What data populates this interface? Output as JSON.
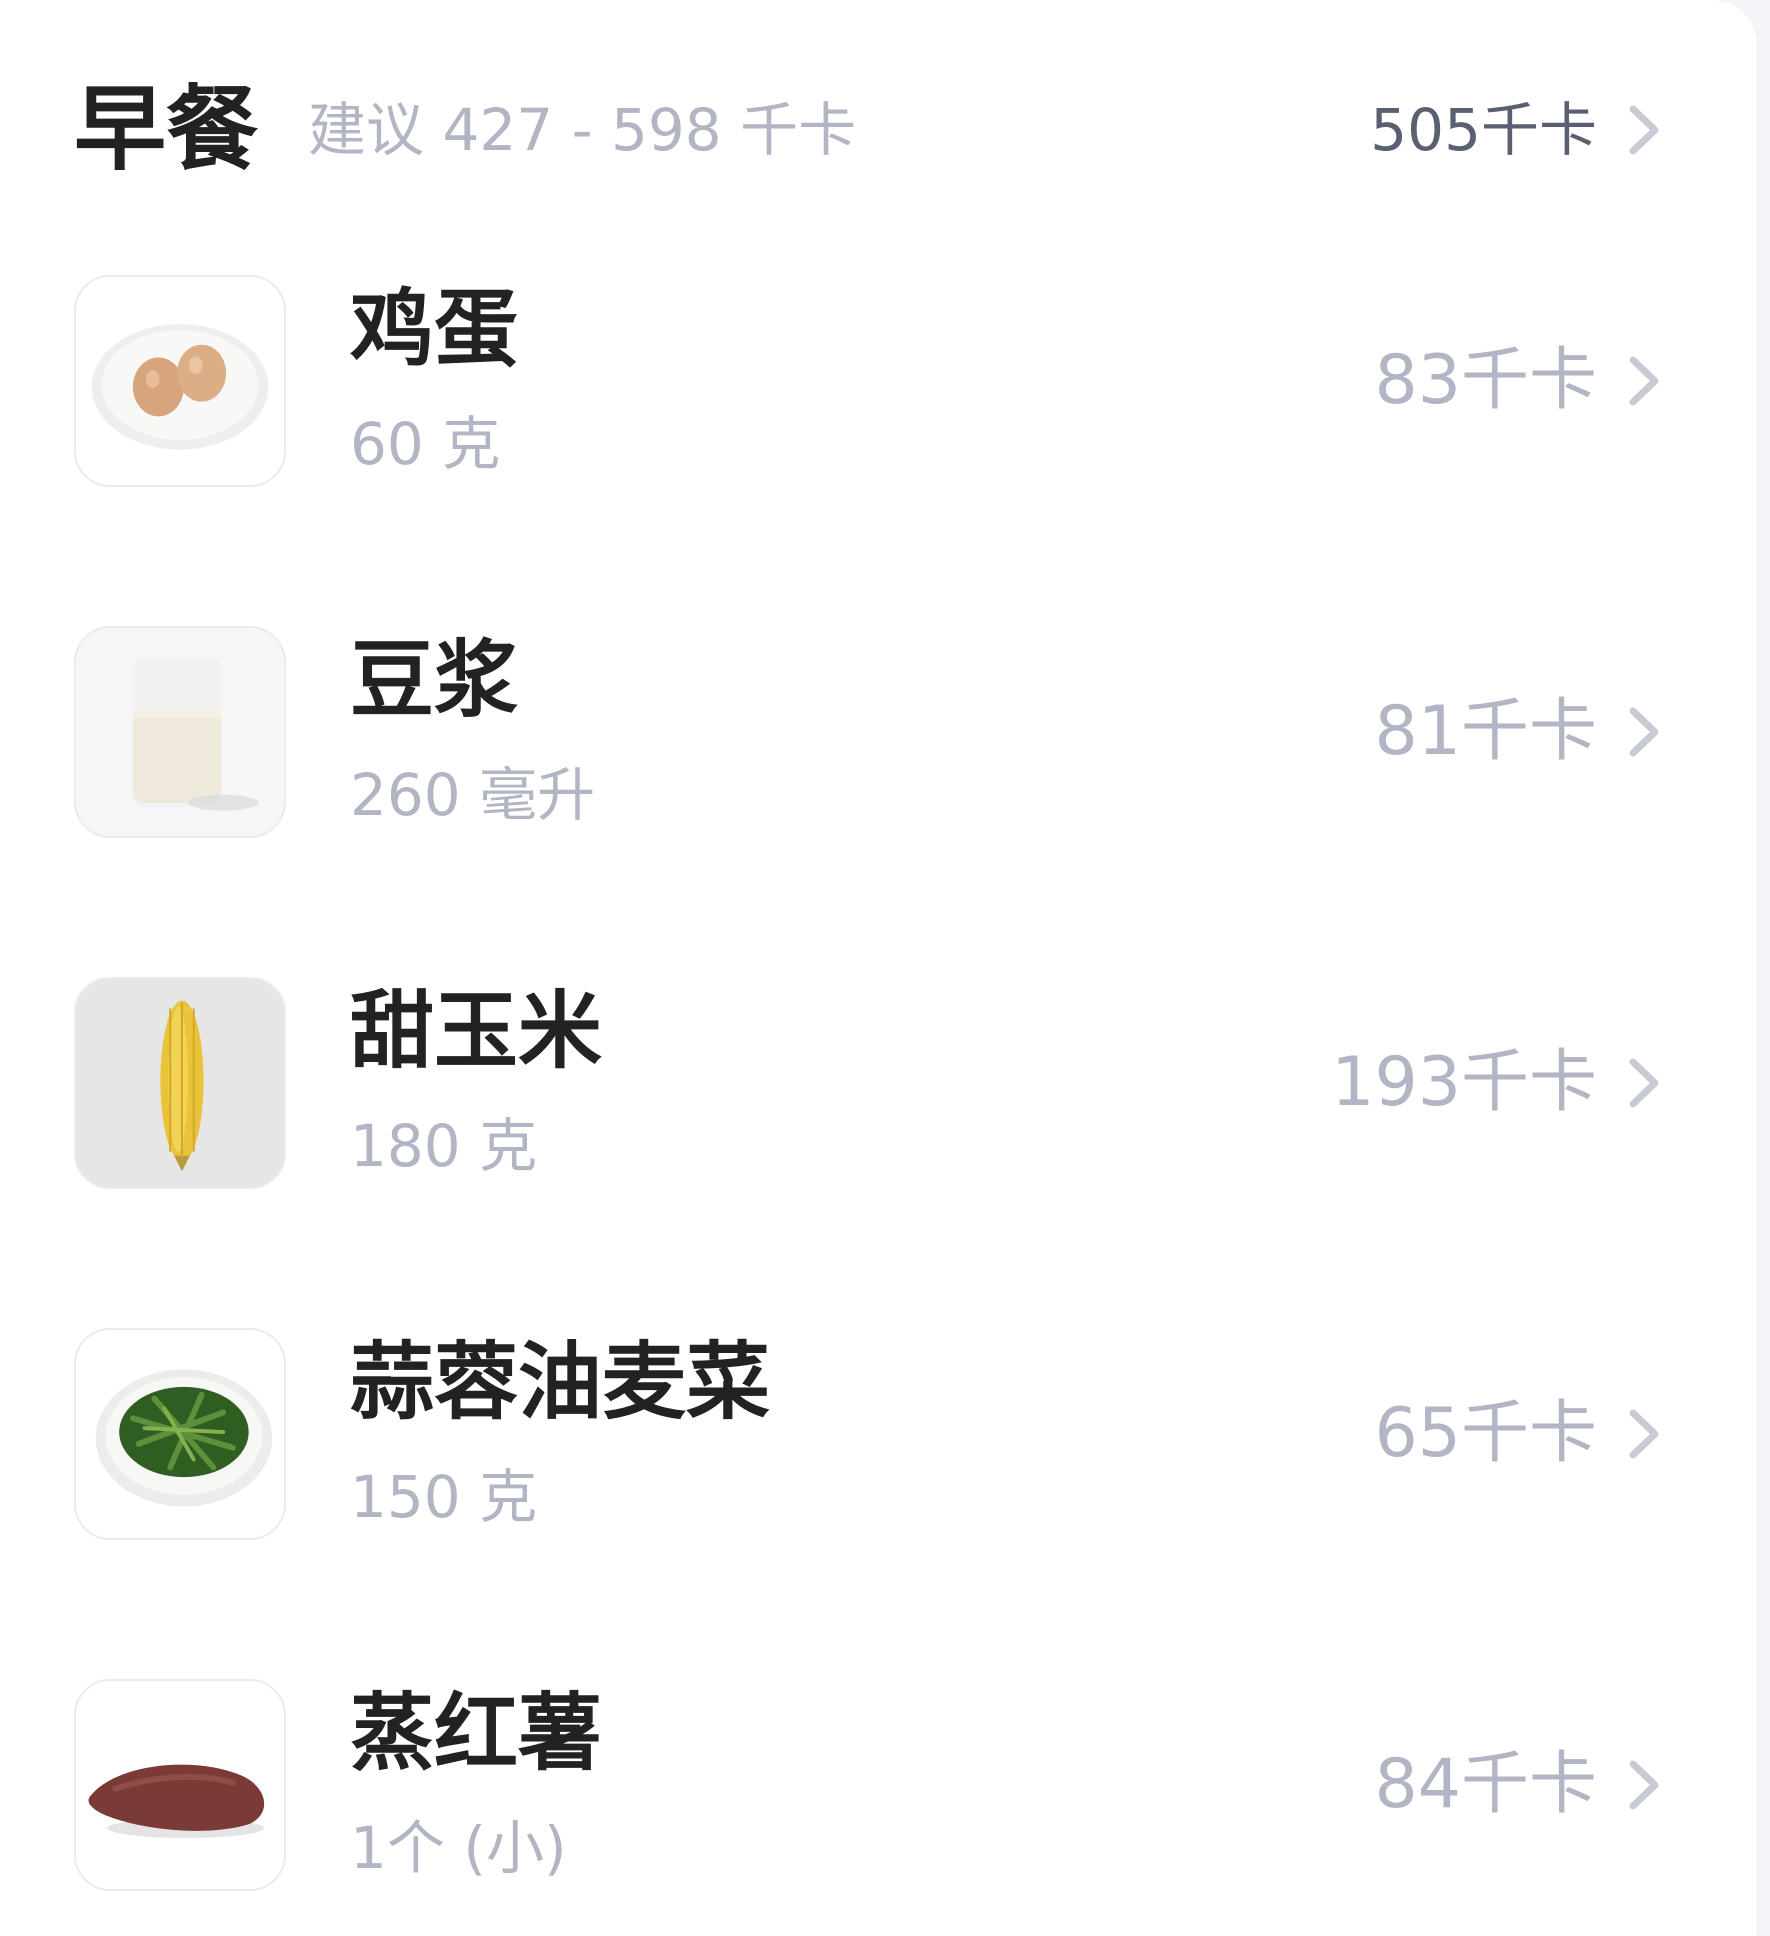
{
  "meal": {
    "title": "早餐",
    "suggestion": "建议 427 - 598 千卡",
    "total": "505千卡"
  },
  "colors": {
    "title_text": "#222222",
    "secondary_text": "#b2b5c4",
    "total_text": "#5a6072",
    "chevron": "#c8cbd4"
  },
  "items": [
    {
      "name": "鸡蛋",
      "amount": "60 克",
      "kcal": "83千卡",
      "image": "eggs-on-plate"
    },
    {
      "name": "豆浆",
      "amount": "260 毫升",
      "kcal": "81千卡",
      "image": "soy-milk-glass"
    },
    {
      "name": "甜玉米",
      "amount": "180 克",
      "kcal": "193千卡",
      "image": "sweet-corn"
    },
    {
      "name": "蒜蓉油麦菜",
      "amount": "150 克",
      "kcal": "65千卡",
      "image": "garlic-lettuce-plate"
    },
    {
      "name": "蒸红薯",
      "amount": "1个 (小)",
      "kcal": "84千卡",
      "image": "steamed-sweet-potato"
    }
  ]
}
